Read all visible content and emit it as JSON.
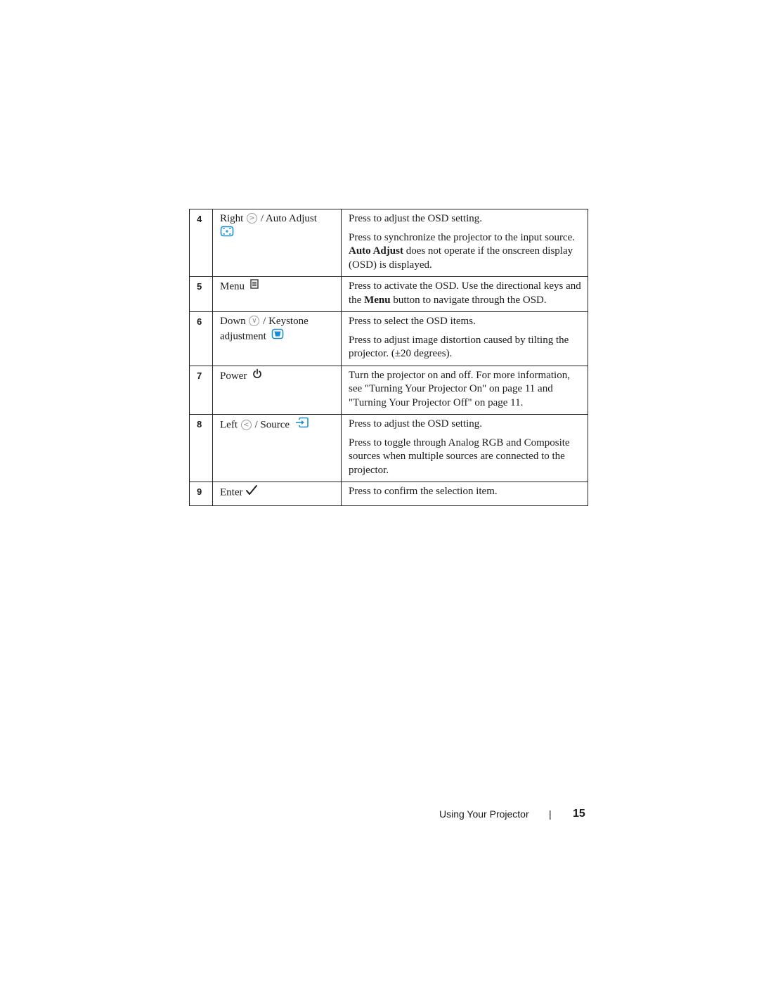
{
  "rows": [
    {
      "number": "4",
      "name_primary": "Right",
      "name_secondary": "/ Auto Adjust",
      "icons": [
        "chevron-right-circle-icon",
        "auto-adjust-icon"
      ],
      "desc": [
        "Press to adjust the OSD setting.",
        {
          "before": "Press to synchronize the projector to the input source. ",
          "bold": "Auto Adjust",
          "after": " does not operate if the onscreen display (OSD) is displayed."
        }
      ]
    },
    {
      "number": "5",
      "name_primary": "Menu",
      "icons": [
        "menu-icon"
      ],
      "desc": [
        {
          "before": "Press to activate the OSD. Use the directional keys and the ",
          "bold": "Menu",
          "after": " button to navigate through the OSD."
        }
      ]
    },
    {
      "number": "6",
      "name_primary": "Down",
      "name_secondary": "/ Keystone",
      "name_tertiary": "adjustment",
      "icons": [
        "chevron-down-circle-icon",
        "keystone-icon"
      ],
      "desc": [
        "Press to select the OSD items.",
        "Press to adjust image distortion caused by tilting the projector. (±20 degrees)."
      ]
    },
    {
      "number": "7",
      "name_primary": "Power",
      "icons": [
        "power-icon"
      ],
      "desc": [
        "Turn the projector on and off. For more information, see \"Turning Your Projector On\" on page 11 and \"Turning Your Projector Off\" on page 11."
      ]
    },
    {
      "number": "8",
      "name_primary": "Left",
      "name_secondary": "/ Source",
      "icons": [
        "chevron-left-circle-icon",
        "source-icon"
      ],
      "desc": [
        "Press to adjust the OSD setting.",
        "Press to toggle through Analog RGB and Composite sources when multiple sources are connected to the projector."
      ]
    },
    {
      "number": "9",
      "name_primary": "Enter",
      "icons": [
        "checkmark-icon"
      ],
      "desc": [
        "Press to confirm the selection item."
      ]
    }
  ],
  "footer": {
    "section": "Using Your Projector",
    "separator": "|",
    "page_number": "15"
  },
  "colors": {
    "icon_blue": "#1b8fcf",
    "icon_gray": "#9a9a9a",
    "text": "#1a1a1a"
  }
}
